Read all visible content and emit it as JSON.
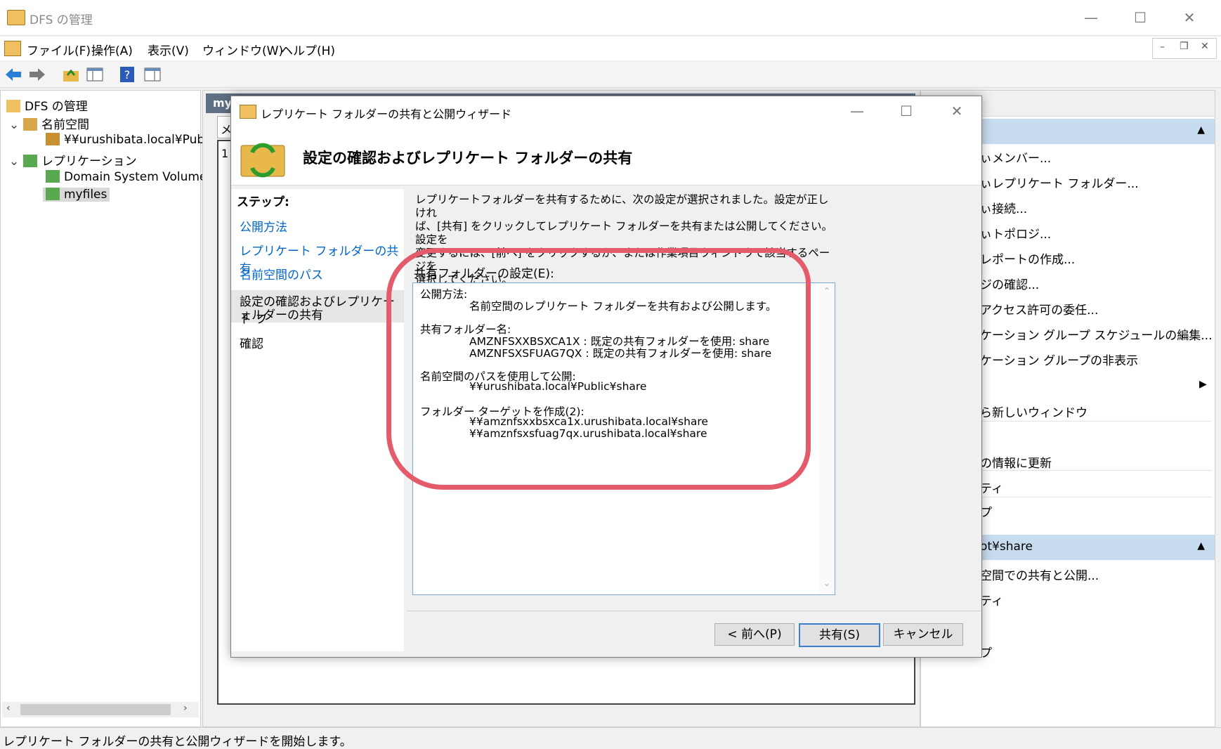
{
  "window": {
    "title": "DFS の管理",
    "controls": {
      "minimize": "—",
      "maximize": "☐",
      "close": "✕"
    }
  },
  "menubar": [
    "ファイル(F)",
    "操作(A)",
    "表示(V)",
    "ウィンドウ(W)",
    "ヘルプ(H)"
  ],
  "tree": {
    "root": "DFS の管理",
    "namespaces": "名前空間",
    "namespace_item": "¥¥urushibata.local¥Publ",
    "replication": "レプリケーション",
    "rep_items": [
      "Domain System Volume",
      "myfiles"
    ]
  },
  "middle": {
    "tab_fragment": "my",
    "col_fragment": "メン",
    "row_fragment": "1"
  },
  "actions": {
    "items_top": [
      "ぃメンバー...",
      "ぃレプリケート フォルダー...",
      "ぃ接続...",
      "ぃトポロジ...",
      "レポートの作成...",
      "ジの確認...",
      "アクセス許可の委任...",
      "ケーション グループ スケジュールの編集...",
      "ケーション グループの非表示"
    ],
    "new_window": "ら新しいウィンドウ",
    "refresh": "の情報に更新",
    "property": "ティ",
    "help_frag": "プ",
    "section2_title": "ot¥share",
    "items_bottom": [
      "空間での共有と公開...",
      "ティ",
      "プ"
    ]
  },
  "status": "レプリケート フォルダーの共有と公開ウィザードを開始します。",
  "dialog": {
    "title": "レプリケート フォルダーの共有と公開ウィザード",
    "header": "設定の確認およびレプリケート フォルダーの共有",
    "steps_label": "ステップ:",
    "steps": [
      "公開方法",
      "レプリケート フォルダーの共有",
      "名前空間のパス"
    ],
    "current_step_line1": "設定の確認およびレプリケート フ",
    "current_step_line2": "ォルダーの共有",
    "last_step": "確認",
    "description_lines": [
      "レプリケートフォルダーを共有するために、次の設定が選択されました。設定が正しけれ",
      "ば、[共有] をクリックしてレプリケート フォルダーを共有または公開してください。設定を",
      "変更するには、[前へ] をクリックするか、または作業項目ウィンドウで該当するページを",
      "選択してください。"
    ],
    "settings_label": "共有フォルダーの設定(E):",
    "settings": {
      "method_label": "公開方法:",
      "method_value": "名前空間のレプリケート フォルダーを共有および公開します。",
      "shared_label": "共有フォルダー名:",
      "shared_1": "AMZNFSXXBSXCA1X : 既定の共有フォルダーを使用: share",
      "shared_2": "AMZNFSXSFUAG7QX : 既定の共有フォルダーを使用: share",
      "ns_label": "名前空間のパスを使用して公開:",
      "ns_value": "¥¥urushibata.local¥Public¥share",
      "target_label": "フォルダー ターゲットを作成(2):",
      "target_1": "¥¥amznfsxxbsxca1x.urushibata.local¥share",
      "target_2": "¥¥amznfsxsfuag7qx.urushibata.local¥share"
    },
    "buttons": {
      "back": "< 前へ(P)",
      "share": "共有(S)",
      "cancel": "キャンセル"
    }
  },
  "colors": {
    "annotation": "#e45b6b",
    "link": "#0066cc",
    "selected": "#e6e6e6"
  }
}
